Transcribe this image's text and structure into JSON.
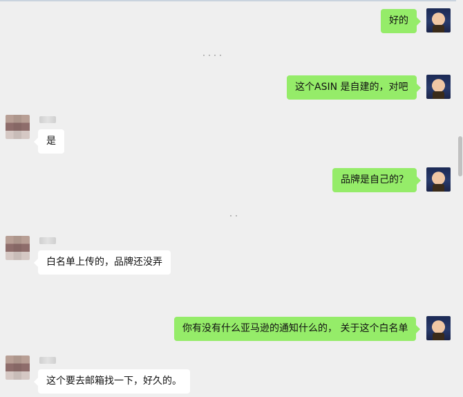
{
  "chat": {
    "messages": [
      {
        "from": "me",
        "text": "好的"
      },
      {
        "from": "me",
        "text": "这个ASIN 是自建的，对吧"
      },
      {
        "from": "other",
        "text": "是"
      },
      {
        "from": "me",
        "text": "品牌是自己的？"
      },
      {
        "from": "other",
        "text": "白名单上传的，品牌还没弄"
      },
      {
        "from": "me",
        "text": "你有没有什么亚马逊的通知什么的， 关于这个白名单"
      },
      {
        "from": "other",
        "text": "这个要去邮箱找一下，好久的。"
      }
    ]
  },
  "colors": {
    "background": "#efefef",
    "my_bubble": "#95ec69",
    "other_bubble": "#ffffff"
  },
  "icons": {
    "my_avatar": "avatar-photo",
    "other_avatar": "avatar-photo-pixelated"
  }
}
